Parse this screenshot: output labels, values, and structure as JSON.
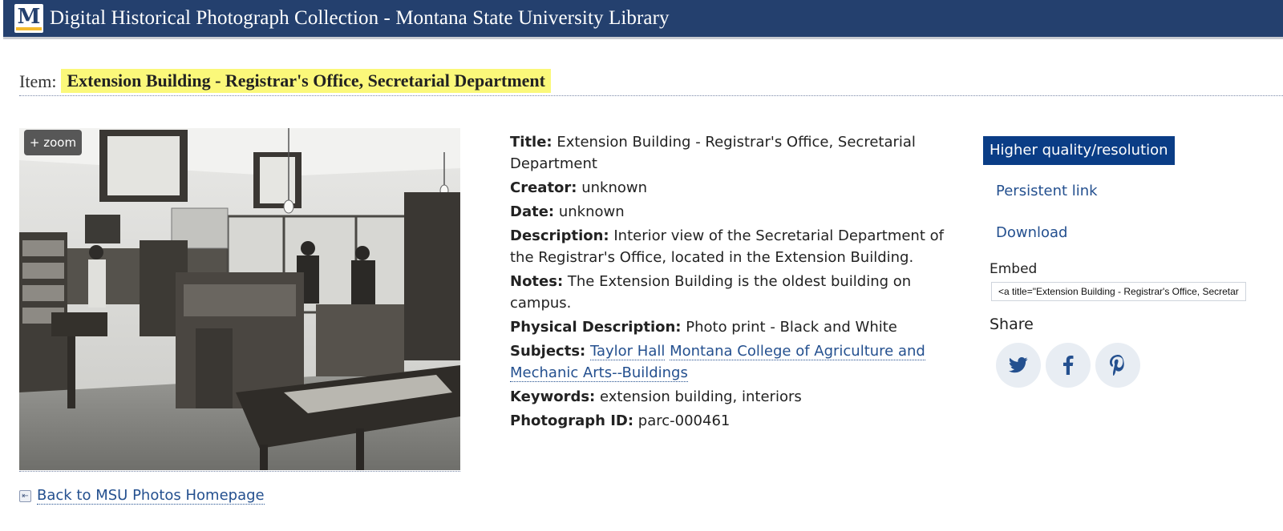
{
  "header": {
    "logo_letter": "M",
    "site_title": "Digital Historical Photograph Collection - Montana State University Library",
    "bg_color": "#24406e"
  },
  "item": {
    "label": "Item:",
    "title": "Extension Building - Registrar's Office, Secretarial Department",
    "highlight_color": "#fbf87a"
  },
  "photo": {
    "zoom_label": "+ zoom"
  },
  "metadata": {
    "title_label": "Title:",
    "title_value": "Extension Building - Registrar's Office, Secretarial Department",
    "creator_label": "Creator:",
    "creator_value": "unknown",
    "date_label": "Date:",
    "date_value": "unknown",
    "description_label": "Description:",
    "description_value": "Interior view of the Secretarial Department of the Registrar's Office, located in the Extension Building.",
    "notes_label": "Notes:",
    "notes_value": "The Extension Building is the oldest building on campus.",
    "physical_label": "Physical Description:",
    "physical_value": "Photo print - Black and White",
    "subjects_label": "Subjects:",
    "subjects": [
      "Taylor Hall",
      "Montana College of Agriculture and Mechanic Arts--Buildings"
    ],
    "keywords_label": "Keywords:",
    "keywords_value": "extension building, interiors",
    "photo_id_label": "Photograph ID:",
    "photo_id_value": "parc-000461"
  },
  "sidebar": {
    "hq_button": "Higher quality/resolution",
    "persistent_link": "Persistent link",
    "download": "Download",
    "embed_label": "Embed",
    "embed_value": "<a title=\"Extension Building - Registrar's Office, Secretarial Department\"",
    "share_label": "Share",
    "share_icons": [
      "twitter-icon",
      "facebook-icon",
      "pinterest-icon"
    ]
  },
  "footer": {
    "back_link": "Back to MSU Photos Homepage"
  }
}
